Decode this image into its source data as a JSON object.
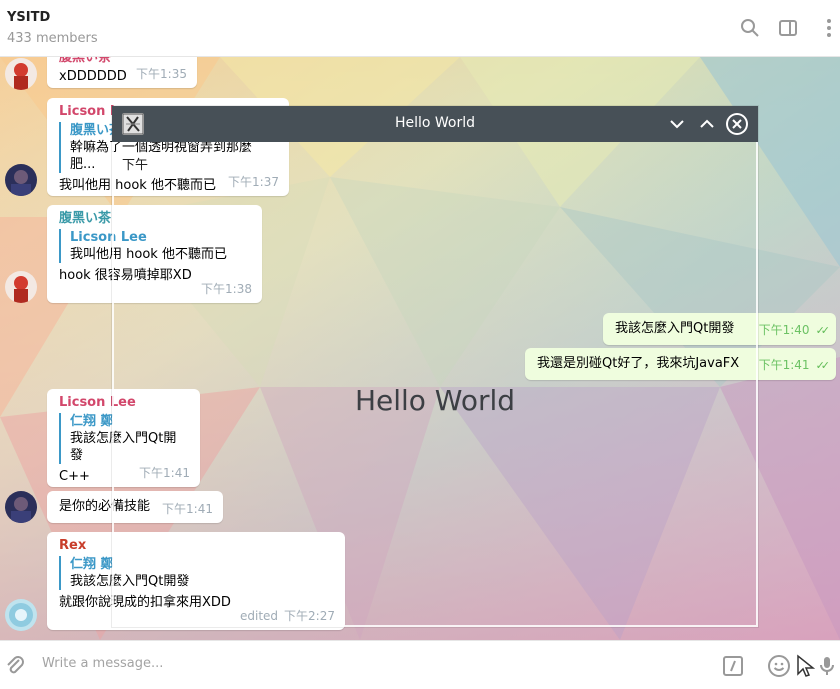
{
  "header": {
    "title": "YSITD",
    "subtitle": "433 members",
    "icons": [
      "search-icon",
      "sidebar-toggle-icon",
      "more-icon"
    ]
  },
  "messages": [
    {
      "sender": "腹黑い茶",
      "text": "xDDDDDD",
      "time": "下午1:35"
    },
    {
      "sender": "Licson Lee",
      "reply_to": "腹黑い茶",
      "reply_text": "幹嘛為了一個透明視窗弄到那麼肥...",
      "text": "我叫他用 hook 他不聽而已",
      "time": "下午1:37"
    },
    {
      "sender": "腹黑い茶",
      "reply_to": "Licson Lee",
      "reply_text": "我叫他用 hook 他不聽而已",
      "text": "hook 很容易噴掉耶XD",
      "time": "下午1:38"
    },
    {
      "text": "我該怎麼入門Qt開發",
      "time": "下午1:40",
      "outgoing": true
    },
    {
      "text": "我還是別碰Qt好了，我來坑JavaFX",
      "time": "下午1:41",
      "outgoing": true
    },
    {
      "sender": "Licson Lee",
      "reply_to": "仁翔 鄭",
      "reply_text": "我該怎麼入門Qt開發",
      "text": "C++",
      "time": "下午1:41"
    },
    {
      "text": "是你的必備技能",
      "time": "下午1:41"
    },
    {
      "sender": "Rex",
      "reply_to": "仁翔 鄭",
      "reply_text": "我該怎麼入門Qt開發",
      "text": "就跟你說現成的扣拿來用XDD",
      "time": "下午2:27",
      "edited": "edited"
    }
  ],
  "overlay_window": {
    "title": "Hello World",
    "label": "Hello World",
    "fragment": "下午"
  },
  "composer": {
    "placeholder": "Write a message..."
  },
  "colors": {
    "accent": "#3b98c7",
    "outgoing_bubble": "#effdde",
    "titlebar": "#475057"
  }
}
